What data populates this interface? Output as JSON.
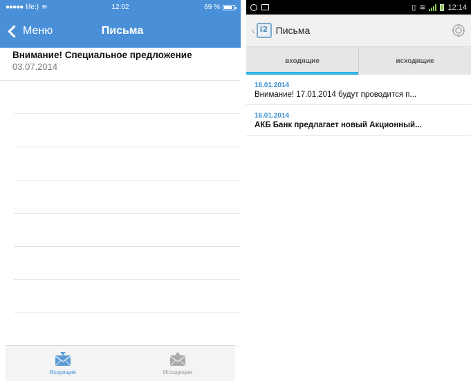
{
  "ios": {
    "status": {
      "carrier": "life:)",
      "time": "12:02",
      "battery": "69 %"
    },
    "nav": {
      "back_label": "Меню",
      "title": "Письма"
    },
    "messages": [
      {
        "subject": "Внимание! Специальное предложение",
        "date": "03.07.2014"
      }
    ],
    "tabs": [
      {
        "label": "Входящие",
        "icon": "envelope-inbox-icon",
        "active": true
      },
      {
        "label": "Исходящие",
        "icon": "envelope-outbox-icon",
        "active": false
      }
    ],
    "colors": {
      "accent": "#4a90d9"
    }
  },
  "android": {
    "status": {
      "time": "12:14"
    },
    "actionbar": {
      "title": "Письма",
      "logo": "app-logo-icon",
      "settings": "settings-icon"
    },
    "tabs": [
      {
        "label": "входящие",
        "active": true
      },
      {
        "label": "исходящие",
        "active": false
      }
    ],
    "messages": [
      {
        "date": "16.01.2014",
        "subject": "Внимание! 17.01.2014 будут проводится п...",
        "unread": false
      },
      {
        "date": "16.01.2014",
        "subject": "АКБ Банк предлагает новый Акционный...",
        "unread": true
      }
    ],
    "colors": {
      "accent": "#33b5e5"
    }
  }
}
